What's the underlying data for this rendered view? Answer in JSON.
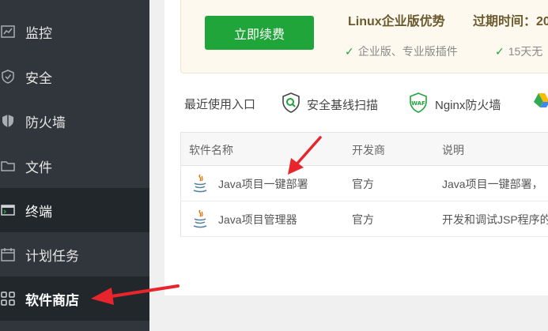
{
  "sidebar": {
    "items": [
      {
        "label": "监控",
        "icon": "monitor-icon"
      },
      {
        "label": "安全",
        "icon": "shield-icon"
      },
      {
        "label": "防火墙",
        "icon": "firewall-shield-icon"
      },
      {
        "label": "文件",
        "icon": "folder-icon"
      },
      {
        "label": "终端",
        "icon": "terminal-icon"
      },
      {
        "label": "计划任务",
        "icon": "calendar-icon"
      },
      {
        "label": "软件商店",
        "icon": "grid-icon"
      }
    ]
  },
  "renew": {
    "button_label": "立即续费",
    "title": "Linux企业版优势",
    "expire_label": "过期时间：20",
    "features": [
      "企业版、专业版插件",
      "15天无"
    ]
  },
  "recent": {
    "label": "最近使用入口",
    "items": [
      {
        "label": "安全基线扫描",
        "icon": "security-scan-icon"
      },
      {
        "label": "Nginx防火墙",
        "icon": "waf-icon"
      },
      {
        "label": "",
        "icon": "google-drive-icon"
      }
    ]
  },
  "table": {
    "headers": [
      "软件名称",
      "开发商",
      "说明"
    ],
    "rows": [
      {
        "name": "Java项目一键部署",
        "vendor": "官方",
        "desc": "Java项目一键部署，"
      },
      {
        "name": "Java项目管理器",
        "vendor": "官方",
        "desc": "开发和调试JSP程序的"
      }
    ]
  },
  "colors": {
    "sidebar_bg": "#31363c",
    "accent_green": "#20a53a",
    "arrow_red": "#e8252c"
  }
}
